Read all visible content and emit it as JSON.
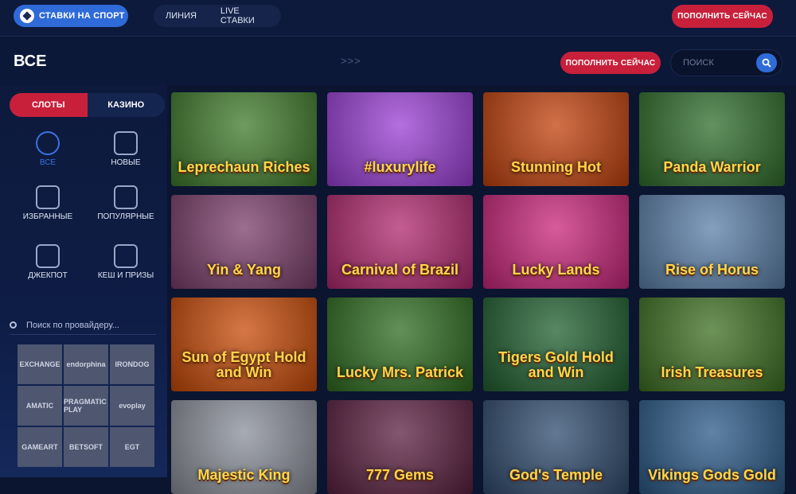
{
  "header": {
    "brand_label": "СТАВКИ НА СПОРТ",
    "nav": [
      "ЛИНИЯ",
      "LIVE СТАВКИ"
    ],
    "deposit_label": "ПОПОЛНИТЬ СЕЙЧАС"
  },
  "page": {
    "title": "ВСЕ",
    "arrows": ">>>",
    "deposit_label": "ПОПОЛНИТЬ СЕЙЧАС",
    "search_placeholder": "ПОИСК"
  },
  "sidebar": {
    "tabs": [
      "СЛОТЫ",
      "КАЗИНО"
    ],
    "categories": [
      "ВСЕ",
      "НОВЫЕ",
      "ИЗБРАННЫЕ",
      "ПОПУЛЯРНЫЕ",
      "ДЖЕКПОТ",
      "КЕШ И ПРИЗЫ"
    ],
    "provider_search_placeholder": "Поиск по провайдеру...",
    "providers": [
      "EXCHANGE",
      "endorphina",
      "IRONDOG",
      "AMATIC",
      "PRAGMATIC PLAY",
      "evoplay",
      "GAMEART",
      "BETSOFT",
      "EGT"
    ]
  },
  "games": [
    {
      "name": "Leprechaun Riches",
      "color": "#3e7a2a"
    },
    {
      "name": "#luxurylife",
      "color": "#9a3fd4"
    },
    {
      "name": "Stunning Hot",
      "color": "#c2410c"
    },
    {
      "name": "Panda Warrior",
      "color": "#2f6d2a"
    },
    {
      "name": "Yin & Yang",
      "color": "#7a3d6a"
    },
    {
      "name": "Carnival of Brazil",
      "color": "#b0286e"
    },
    {
      "name": "Lucky Lands",
      "color": "#c9257a"
    },
    {
      "name": "Rise of Horus",
      "color": "#5a7fa8"
    },
    {
      "name": "Sun of Egypt Hold and Win",
      "color": "#c84a07"
    },
    {
      "name": "Lucky Mrs. Patrick",
      "color": "#2d6b1f"
    },
    {
      "name": "Tigers Gold Hold and Win",
      "color": "#1f5f2f"
    },
    {
      "name": "Irish Treasures",
      "color": "#3d6f21"
    },
    {
      "name": "Majestic King",
      "color": "#8a8f99"
    },
    {
      "name": "777 Gems",
      "color": "#5a1f3f"
    },
    {
      "name": "God's Temple",
      "color": "#2f4b6e"
    },
    {
      "name": "Vikings Gods Gold",
      "color": "#2b5a88"
    }
  ],
  "colors": {
    "accent_red": "#c8203a",
    "accent_blue": "#2f6bd8"
  }
}
